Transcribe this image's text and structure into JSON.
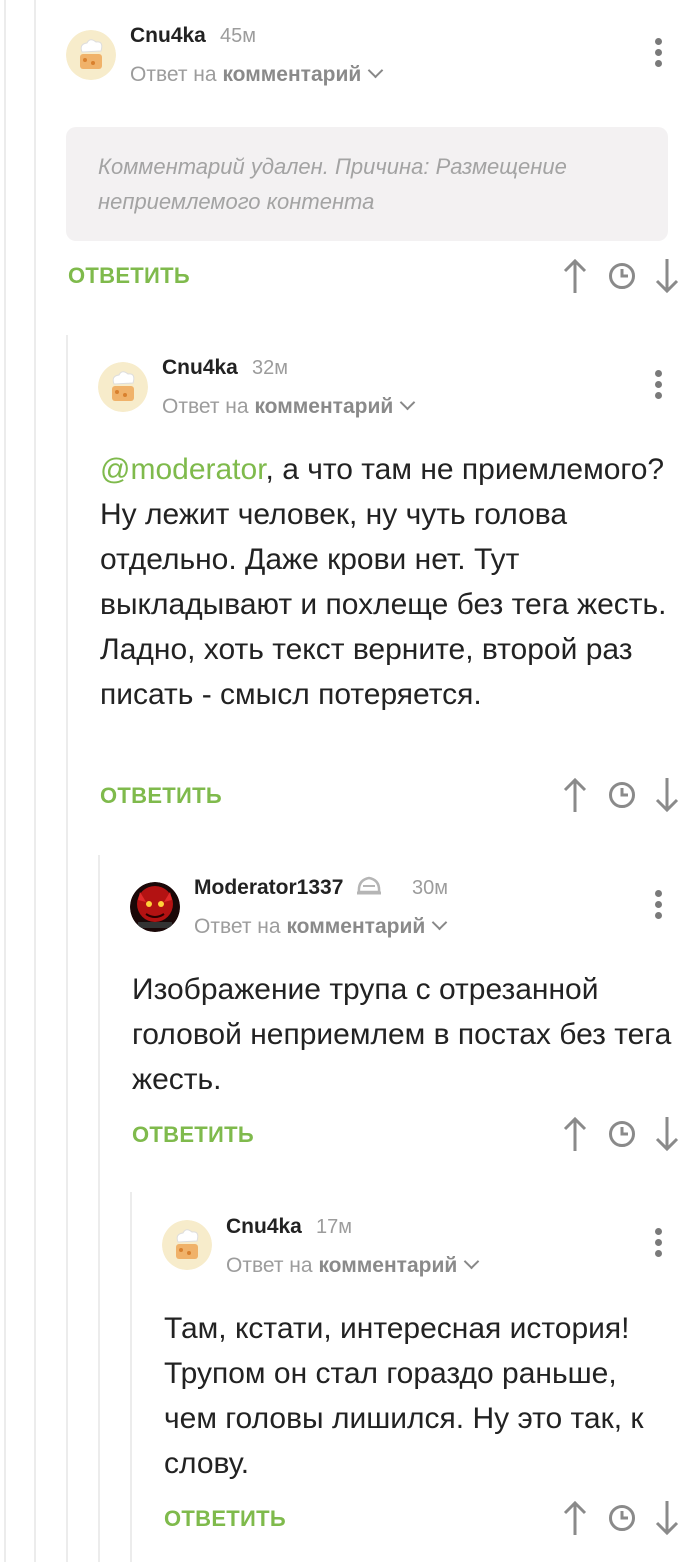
{
  "ui": {
    "reply_button": "ОТВЕТИТЬ",
    "reply_to_prefix": "Ответ на",
    "reply_to_link": "комментарий",
    "accent_color": "#7fba4c"
  },
  "comments": [
    {
      "author": "Cnu4ka",
      "time": "45м",
      "avatar_icon": "chef-cake-avatar",
      "deleted_notice": "Комментарий удален. Причина: Размещение неприемлемого контента"
    },
    {
      "author": "Cnu4ka",
      "time": "32м",
      "avatar_icon": "chef-cake-avatar",
      "mention": "@moderator",
      "text": ", а что там не приемлемого? Ну лежит человек, ну чуть голова отдельно. Даже крови нет. Тут выкладывают и похлеще без тега жесть. Ладно, хоть текст верните, второй раз писать - смысл потеряется."
    },
    {
      "author": "Moderator1337",
      "time": "30м",
      "avatar_icon": "red-demon-avatar",
      "badge_icon": "moderator-hat-icon",
      "text": "Изображение трупа с отрезанной головой неприемлем в постах без тега жесть."
    },
    {
      "author": "Cnu4ka",
      "time": "17м",
      "avatar_icon": "chef-cake-avatar",
      "text": "Там, кстати, интересная история! Трупом он стал гораздо раньше, чем головы лишился. Ну это так, к слову."
    }
  ]
}
